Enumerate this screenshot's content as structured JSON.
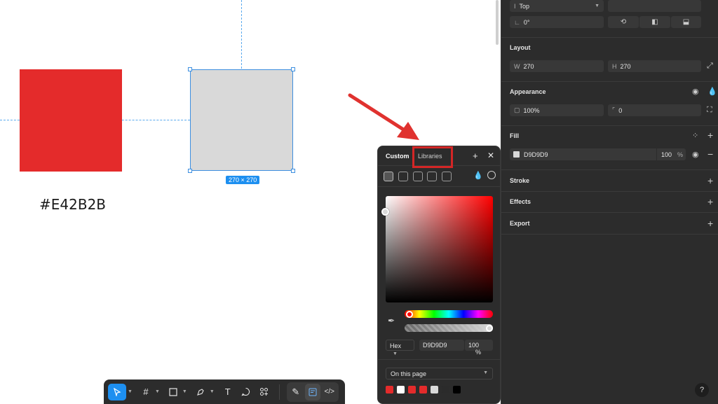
{
  "canvas": {
    "red_square_color": "#E42B2B",
    "red_hex_label": "#E42B2B",
    "gray_square_color": "#D9D9D9",
    "selection_size": "270 × 270"
  },
  "picker": {
    "tab_custom": "Custom",
    "tab_libraries": "Libraries",
    "hex_mode": "Hex",
    "hex_value": "D9D9D9",
    "opacity": "100",
    "opacity_unit": "%",
    "library_scope": "On this page",
    "swatches": [
      "#e42b2b",
      "#ffffff",
      "#e42b2b",
      "#e42b2b",
      "#d9d9d9",
      "#2b2b2b",
      "#000000"
    ]
  },
  "panel": {
    "constraint": "Top",
    "rotation": "0°",
    "layout_title": "Layout",
    "w_label": "W",
    "w_value": "270",
    "h_label": "H",
    "h_value": "270",
    "appearance_title": "Appearance",
    "opacity_value": "100%",
    "radius_value": "0",
    "fill_title": "Fill",
    "fill_hex": "D9D9D9",
    "fill_opacity": "100",
    "fill_opacity_unit": "%",
    "stroke_title": "Stroke",
    "effects_title": "Effects",
    "export_title": "Export"
  },
  "help_label": "?",
  "colors": {
    "accent": "#1d8ff0",
    "highlight": "#d42626",
    "panel_bg": "#2c2c2c"
  }
}
